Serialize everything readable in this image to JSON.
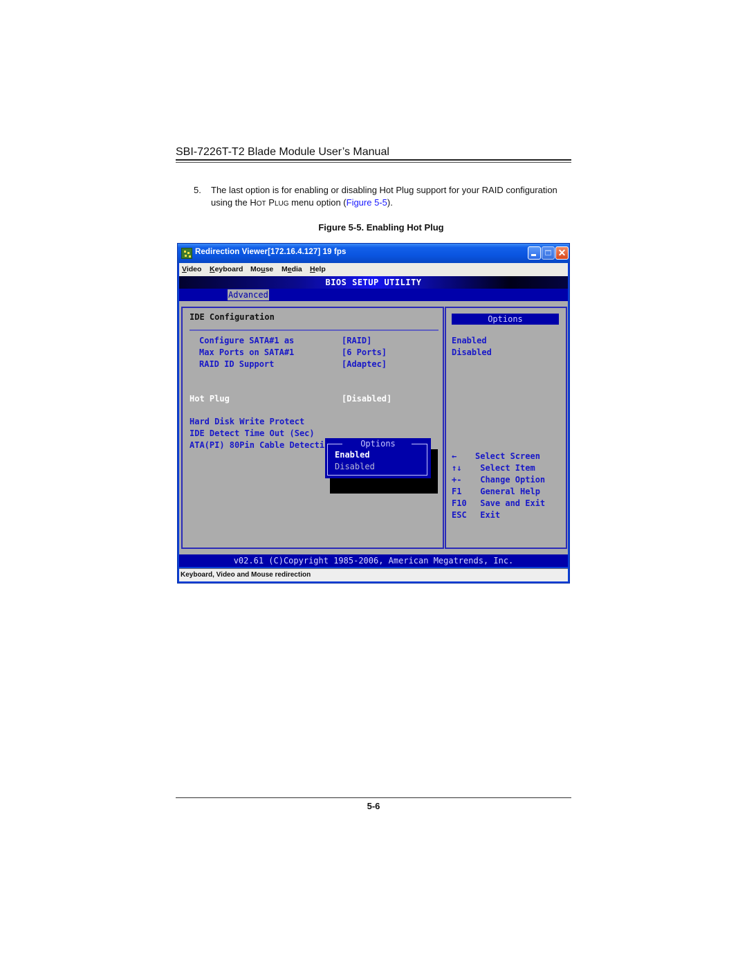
{
  "document": {
    "running_header": "SBI-7226T-T2 Blade Module User’s Manual",
    "paragraph": {
      "number": "5.",
      "text_before": "The last option is for enabling or disabling Hot Plug support for your RAID configuration using the ",
      "smallcaps_h": "H",
      "smallcaps_ot": "OT",
      "smallcaps_p": "P",
      "smallcaps_lug": "LUG",
      "text_mid": " menu option (",
      "link": "Figure 5-5",
      "text_after": ")."
    },
    "caption": "Figure 5-5. Enabling Hot Plug",
    "page_number": "5-6"
  },
  "window": {
    "title": "Redirection Viewer[172.16.4.127]  19 fps",
    "icon": "app-icon",
    "controls": {
      "minimize": "minimize-icon",
      "maximize": "maximize-icon",
      "close": "✕"
    },
    "menu": [
      {
        "label": "Video",
        "mnemonic": "V",
        "rest": "ideo"
      },
      {
        "label": "Keyboard",
        "mnemonic": "K",
        "rest": "eyboard"
      },
      {
        "label": "Mouse",
        "pre": "Mo",
        "mnemonic": "u",
        "rest": "se"
      },
      {
        "label": "Media",
        "pre": "M",
        "mnemonic": "e",
        "rest": "dia"
      },
      {
        "label": "Help",
        "mnemonic": "H",
        "rest": "elp"
      }
    ],
    "status": "Keyboard, Video and Mouse redirection"
  },
  "bios": {
    "title": "BIOS SETUP UTILITY",
    "active_tab": "Advanced",
    "section_title": "IDE Configuration",
    "settings": [
      {
        "label": "Configure SATA#1 as",
        "value": "[RAID]"
      },
      {
        "label": "Max Ports on SATA#1",
        "value": "[6 Ports]"
      },
      {
        "label": "RAID ID Support",
        "value": "[Adaptec]"
      }
    ],
    "hot_plug": {
      "label": "Hot Plug",
      "value": "[Disabled]"
    },
    "other_settings": [
      {
        "label": "Hard Disk Write Protect"
      },
      {
        "label": "IDE Detect Time Out (Sec)"
      },
      {
        "label": "ATA(PI) 80Pin Cable Detecti"
      }
    ],
    "popup": {
      "title": "Options",
      "options": [
        "Enabled",
        "Disabled"
      ],
      "highlighted": "Enabled"
    },
    "help_panel": {
      "title": "Options",
      "items": [
        "Enabled",
        "Disabled"
      ]
    },
    "keys": [
      {
        "key": "←",
        "desc": "Select Screen"
      },
      {
        "key": "↑↓",
        "desc": " Select Item"
      },
      {
        "key": "+-",
        "desc": " Change Option"
      },
      {
        "key": "F1",
        "desc": " General Help"
      },
      {
        "key": "F10",
        "desc": " Save and Exit"
      },
      {
        "key": "ESC",
        "desc": " Exit"
      }
    ],
    "footer": "v02.61 (C)Copyright 1985-2006, American Megatrends, Inc."
  },
  "colors": {
    "bios_background": "#acacac",
    "bios_blue": "#0000aa",
    "bios_text_blue": "#1818c8",
    "link_blue": "#1a1aff"
  }
}
